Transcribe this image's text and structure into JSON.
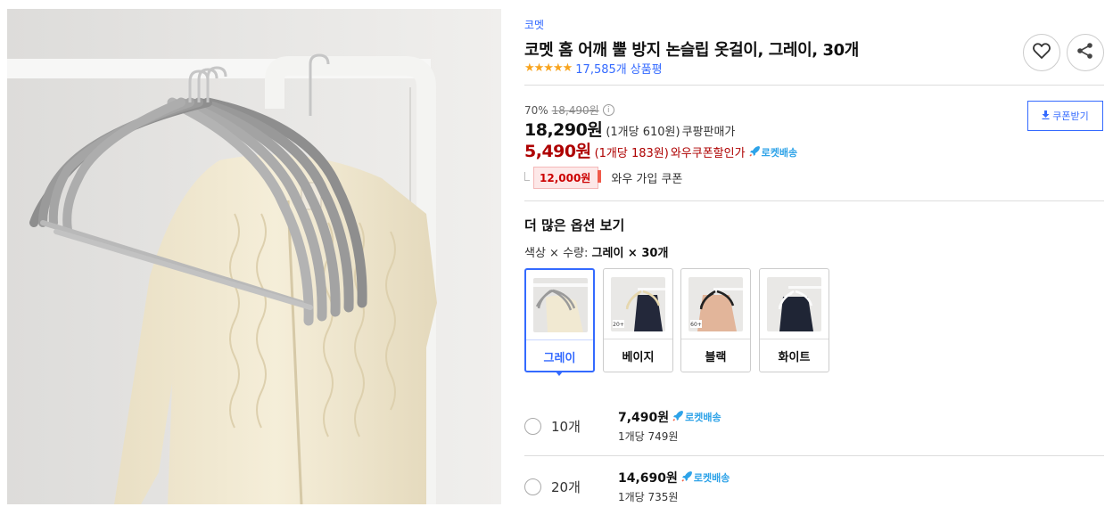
{
  "product": {
    "brand": "코멧",
    "title": "코멧 홈 어깨 뿔 방지 논슬립 옷걸이, 그레이, 30개",
    "stars": "★★★★★",
    "review_count": "17,585개",
    "review_label": "상품평"
  },
  "pricing": {
    "discount_rate": "70%",
    "original_price": "18,490원",
    "sale_price": "18,290원",
    "sale_unit": "(1개당 610원)",
    "sale_tag": "쿠팡판매가",
    "wow_price": "5,490원",
    "wow_unit": "(1개당 183원)",
    "wow_tag": "와우쿠폰할인가",
    "rocket_label": "로켓배송",
    "coupon_amount": "12,000원",
    "coupon_text": "와우 가입 쿠폰",
    "coupon_button": "쿠폰받기"
  },
  "options": {
    "title": "더 많은 옵션 보기",
    "label_prefix": "색상 × 수량:",
    "label_value": "그레이 × 30개",
    "swatches": [
      {
        "name": "그레이",
        "selected": true
      },
      {
        "name": "베이지",
        "badge": "20+"
      },
      {
        "name": "블랙",
        "badge": "60+"
      },
      {
        "name": "화이트"
      }
    ]
  },
  "quantities": [
    {
      "qty": "10개",
      "price": "7,490원",
      "unit": "1개당 749원",
      "rocket": "로켓배송"
    },
    {
      "qty": "20개",
      "price": "14,690원",
      "unit": "1개당 735원",
      "rocket": "로켓배송"
    }
  ],
  "colors": {
    "accent": "#346aff",
    "wow_red": "#ae0000",
    "rocket_blue": "#2ea3e8",
    "star": "#f8a41e"
  },
  "icons": [
    "heart-icon",
    "share-icon",
    "info-icon",
    "download-icon",
    "rocket-icon",
    "radio-icon"
  ]
}
